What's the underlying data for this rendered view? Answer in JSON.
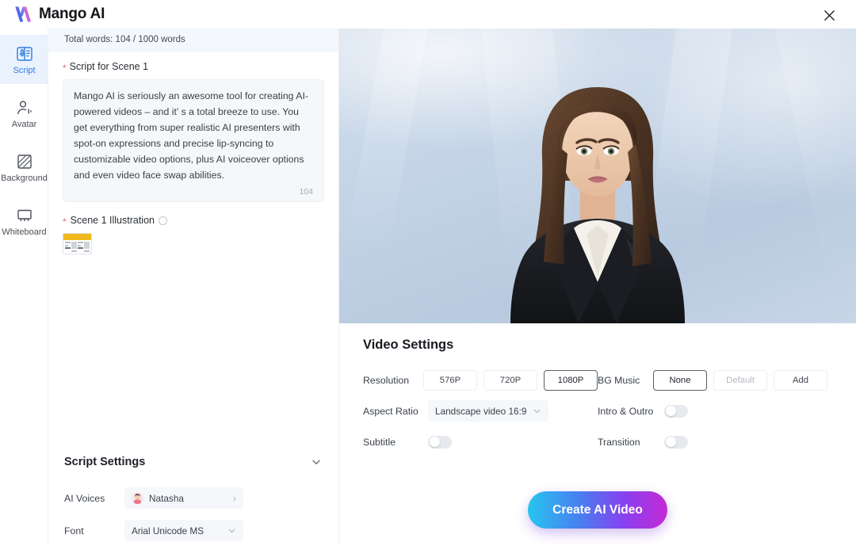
{
  "app": {
    "name": "Mango AI",
    "close_label": "×"
  },
  "rail": {
    "items": [
      {
        "label": "Script",
        "icon": "script-icon",
        "active": true
      },
      {
        "label": "Avatar",
        "icon": "avatar-icon",
        "active": false
      },
      {
        "label": "Background",
        "icon": "background-icon",
        "active": false
      },
      {
        "label": "Whiteboard",
        "icon": "whiteboard-icon",
        "active": false
      }
    ]
  },
  "script_panel": {
    "word_counter": "Total words: 104 / 1000 words",
    "scene_label": "Script for Scene 1",
    "required_marker": "*",
    "script_text": "Mango AI is seriously an awesome tool for creating AI-powered videos – and it’ s a total breeze to use. You get everything from super realistic AI presenters with spot-on expressions and precise lip-syncing to customizable video options, plus AI voiceover options and even video face swap abilities.",
    "script_char_count": "104",
    "illustration_label": "Scene 1 Illustration"
  },
  "script_settings": {
    "title": "Script Settings",
    "collapse_icon": "chevron-down-icon",
    "voices_label": "AI Voices",
    "voice_value": "Natasha",
    "font_label": "Font",
    "font_value": "Arial Unicode MS"
  },
  "video_settings": {
    "title": "Video Settings",
    "resolution_label": "Resolution",
    "resolution_options": [
      "576P",
      "720P",
      "1080P"
    ],
    "resolution_selected": "1080P",
    "aspect_label": "Aspect Ratio",
    "aspect_value": "Landscape video 16:9",
    "subtitle_label": "Subtitle",
    "subtitle_on": false,
    "bg_music_label": "BG Music",
    "bg_music_options": [
      "None",
      "Default",
      "Add"
    ],
    "bg_music_selected": "None",
    "bg_music_disabled": "Default",
    "intro_outro_label": "Intro & Outro",
    "intro_outro_on": false,
    "transition_label": "Transition",
    "transition_on": false,
    "cta_label": "Create AI Video"
  },
  "colors": {
    "accent_blue": "#2e7ce4",
    "cta_start": "#26c6f0",
    "cta_end": "#c42ad4",
    "rail_active_bg": "#eaf2fd"
  }
}
